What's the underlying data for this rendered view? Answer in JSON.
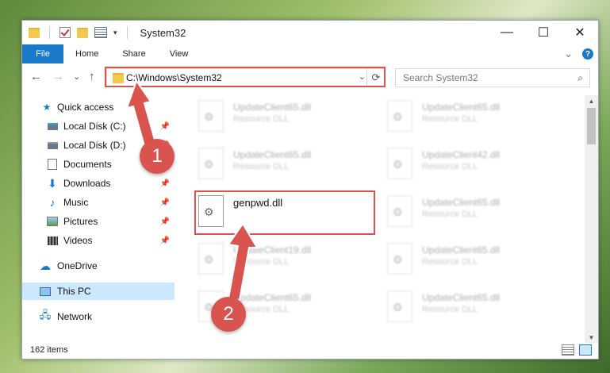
{
  "window": {
    "title": "System32",
    "caption": {
      "minimize": "—",
      "maximize": "☐",
      "close": "✕"
    }
  },
  "ribbon": {
    "tabs": [
      "File",
      "Home",
      "Share",
      "View"
    ],
    "expand_glyph": "⌄",
    "help": "?"
  },
  "address": {
    "path": "C:\\Windows\\System32",
    "dropdown": "⌄",
    "refresh": "⟳"
  },
  "search": {
    "placeholder": "Search System32",
    "icon": "⌕"
  },
  "nav": {
    "back": "←",
    "forward": "→",
    "recent": "⌄",
    "up": "↑"
  },
  "sidebar": {
    "items": [
      {
        "label": "Quick access",
        "icon": "star-icon"
      },
      {
        "label": "Local Disk (C:)",
        "icon": "drive-icon",
        "pinned": true
      },
      {
        "label": "Local Disk (D:)",
        "icon": "drive-icon",
        "pinned": true
      },
      {
        "label": "Documents",
        "icon": "documents-icon",
        "pinned": true
      },
      {
        "label": "Downloads",
        "icon": "download-icon",
        "pinned": true
      },
      {
        "label": "Music",
        "icon": "music-icon",
        "pinned": true
      },
      {
        "label": "Pictures",
        "icon": "pictures-icon",
        "pinned": true
      },
      {
        "label": "Videos",
        "icon": "videos-icon",
        "pinned": true
      },
      {
        "label": "OneDrive",
        "icon": "cloud-icon"
      },
      {
        "label": "This PC",
        "icon": "computer-icon",
        "selected": true
      },
      {
        "label": "Network",
        "icon": "network-icon"
      }
    ],
    "pin_glyph": "📌"
  },
  "files": [
    {
      "name": "UpdateClient65.dll",
      "type": "Resource DLL"
    },
    {
      "name": "UpdateClient65.dll",
      "type": "Resource DLL"
    },
    {
      "name": "UpdateClient65.dll",
      "type": "Resource DLL"
    },
    {
      "name": "UpdateClient42.dll",
      "type": "Resource DLL"
    },
    {
      "name": "genpwd.dll",
      "type": ""
    },
    {
      "name": "UpdateClient65.dll",
      "type": "Resource DLL"
    },
    {
      "name": "UpdateClient19.dll",
      "type": "Resource DLL"
    },
    {
      "name": "UpdateClient65.dll",
      "type": "Resource DLL"
    },
    {
      "name": "UpdateClient65.dll",
      "type": "Resource DLL"
    },
    {
      "name": "UpdateClient65.dll",
      "type": "Resource DLL"
    }
  ],
  "status": {
    "item_count": "162 items"
  },
  "annotations": {
    "step1": "1",
    "step2": "2",
    "color": "#d9534f"
  }
}
